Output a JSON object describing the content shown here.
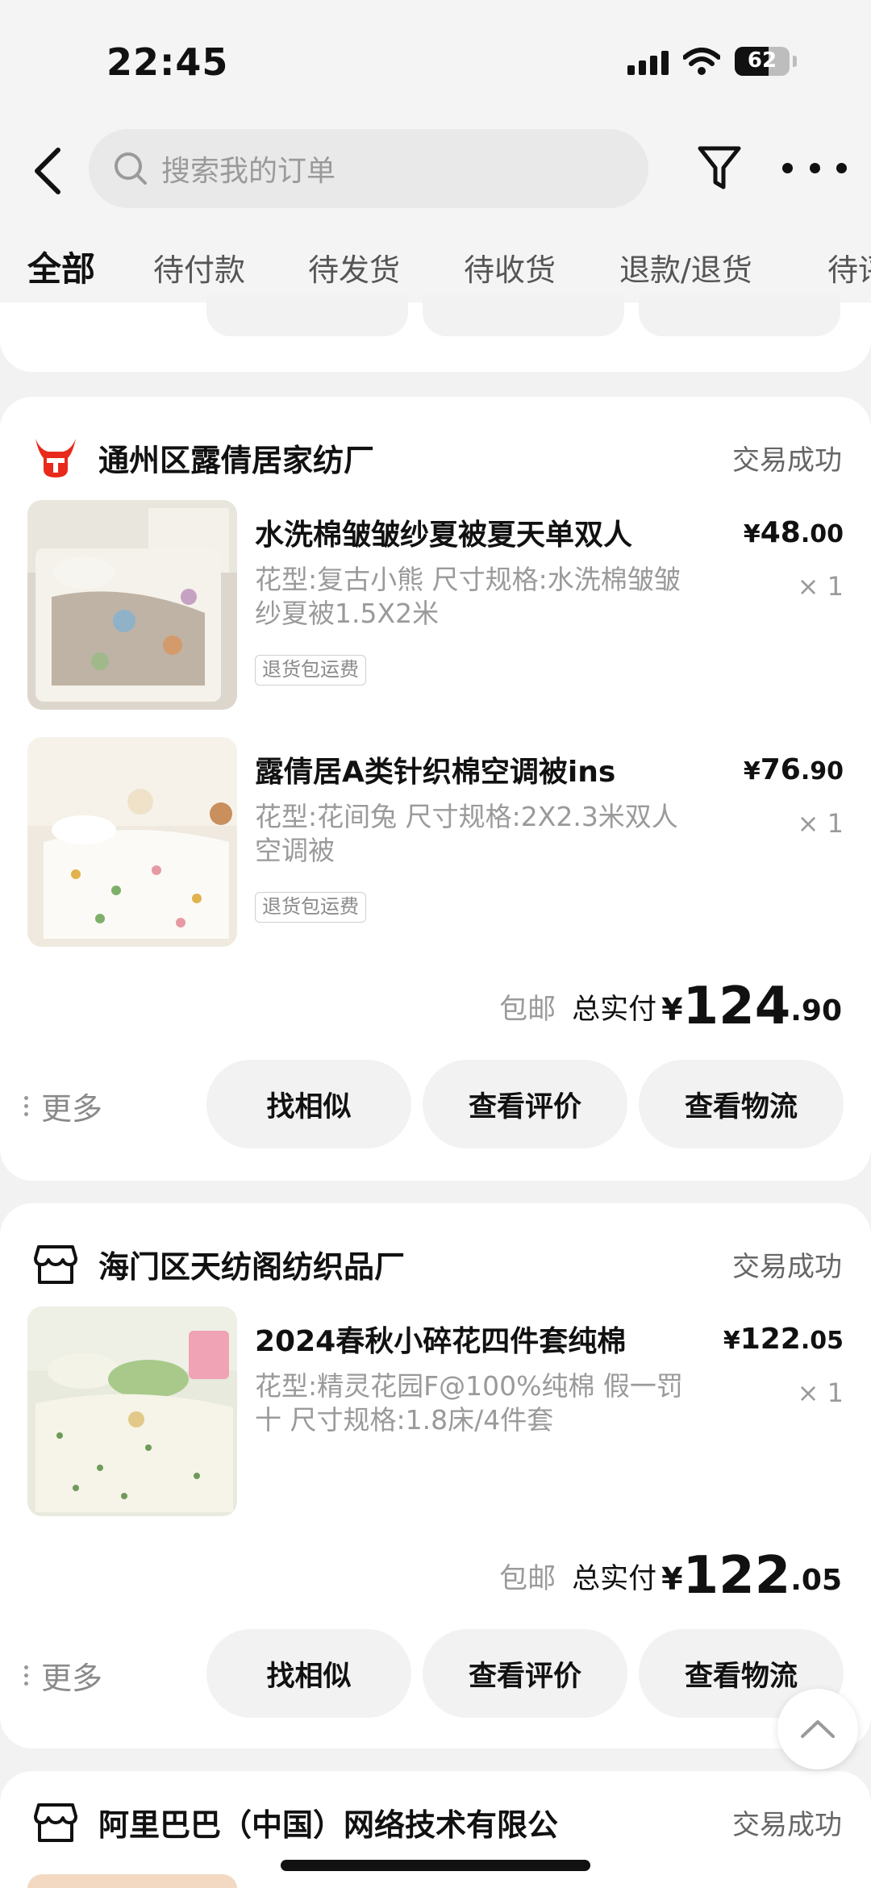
{
  "status_bar": {
    "time": "22:45",
    "battery": "62",
    "battery_level": 0.62
  },
  "header": {
    "search_placeholder": "搜索我的订单",
    "tabs": [
      "全部",
      "待付款",
      "待发货",
      "待收货",
      "退款/退货",
      "待评价"
    ],
    "active_tab": "全部"
  },
  "orders": [
    {
      "shop": "通州区露倩居家纺厂",
      "status": "交易成功",
      "items": [
        {
          "title": "水洗棉皱皱纱夏被夏天单双人",
          "spec": "花型:复古小熊 尺寸规格:水洗棉皱皱纱夏被1.5X2米",
          "tag": "退货包运费",
          "price_yen": "¥",
          "price_int": "48",
          "price_dec": ".00",
          "qty": "× 1"
        },
        {
          "title": "露倩居A类针织棉空调被ins",
          "spec": "花型:花间兔 尺寸规格:2X2.3米双人空调被",
          "tag": "退货包运费",
          "price_yen": "¥",
          "price_int": "76",
          "price_dec": ".90",
          "qty": "× 1"
        }
      ],
      "shipping": "包邮",
      "total_label": "总实付",
      "total_yen": "¥",
      "total_int": "124",
      "total_dec": ".90",
      "more": "更多",
      "actions": [
        "找相似",
        "查看评价",
        "查看物流"
      ]
    },
    {
      "shop": "海门区天纺阁纺织品厂",
      "status": "交易成功",
      "items": [
        {
          "title": "2024春秋小碎花四件套纯棉",
          "spec": "花型:精灵花园F@100%纯棉 假一罚十 尺寸规格:1.8床/4件套",
          "price_yen": "¥",
          "price_int": "122",
          "price_dec": ".05",
          "qty": "× 1"
        }
      ],
      "shipping": "包邮",
      "total_label": "总实付",
      "total_yen": "¥",
      "total_int": "122",
      "total_dec": ".05",
      "more": "更多",
      "actions": [
        "找相似",
        "查看评价",
        "查看物流"
      ]
    },
    {
      "shop": "阿里巴巴（中国）网络技术有限公",
      "status": "交易成功"
    }
  ],
  "colors": {
    "accent_red": "#e8291c",
    "background": "#f2f2f2",
    "muted": "#9a9a9a"
  }
}
